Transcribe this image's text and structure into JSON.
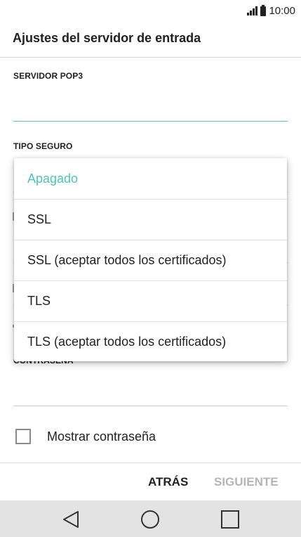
{
  "status_bar": {
    "time": "10:00",
    "signal_icon": "signal-icon",
    "battery_icon": "battery-icon"
  },
  "screen": {
    "title": "Ajustes del servidor de entrada"
  },
  "form": {
    "server_label": "SERVIDOR POP3",
    "server_value": "",
    "security_label": "TIPO SEGURO",
    "password_label": "CONTRASEÑA",
    "show_password_label": "Mostrar contraseña",
    "show_password_checked": false
  },
  "dropdown": {
    "selected": "Apagado",
    "options": [
      {
        "label": "Apagado"
      },
      {
        "label": "SSL"
      },
      {
        "label": "SSL (aceptar todos los certificados)"
      },
      {
        "label": "TLS"
      },
      {
        "label": "TLS (aceptar todos los certificados)"
      }
    ]
  },
  "actions": {
    "back_label": "ATRÁS",
    "next_label": "SIGUIENTE"
  },
  "colors": {
    "accent": "#4fc3b5",
    "disabled": "#b5b5b5",
    "nav_bar": "#e3e3e3"
  },
  "nav_bar": {
    "back_icon": "triangle-back-icon",
    "home_icon": "circle-home-icon",
    "recent_icon": "square-recents-icon"
  }
}
